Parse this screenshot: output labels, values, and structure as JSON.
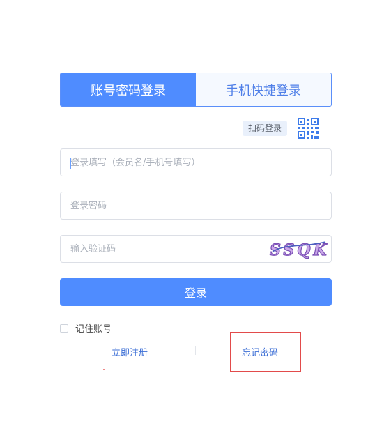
{
  "tabs": [
    {
      "label": "账号密码登录",
      "active": true
    },
    {
      "label": "手机快捷登录",
      "active": false
    }
  ],
  "qr": {
    "label": "扫码登录",
    "icon": "qr-code-icon"
  },
  "form": {
    "username_placeholder": "登录填写（会员名/手机号填写）",
    "password_placeholder": "登录密码",
    "captcha_placeholder": "输入验证码",
    "captcha_text": "SSQK",
    "login_label": "登录",
    "remember_label": "记住账号"
  },
  "links": {
    "register": "立即注册",
    "forgot": "忘记密码"
  },
  "colors": {
    "primary": "#4f8cff",
    "highlight": "#e24b4b"
  }
}
